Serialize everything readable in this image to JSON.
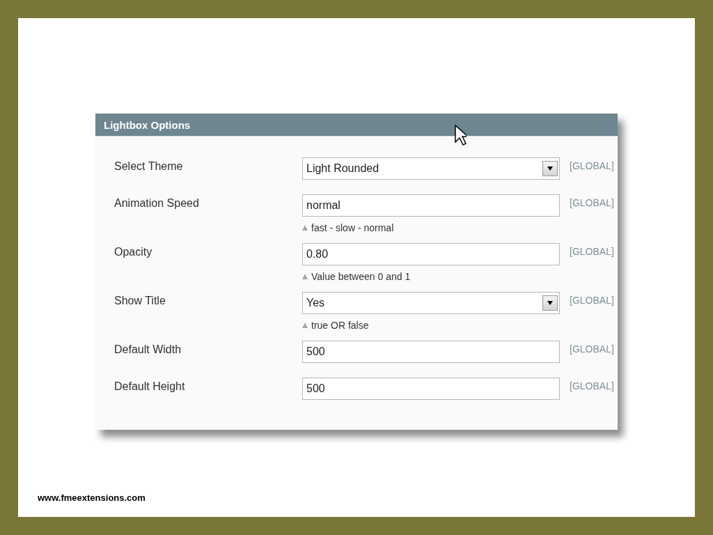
{
  "panel": {
    "title": "Lightbox Options"
  },
  "rows": [
    {
      "label": "Select Theme",
      "kind": "select",
      "value": "Light Rounded",
      "scope": "[GLOBAL]"
    },
    {
      "label": "Animation Speed",
      "kind": "text",
      "value": "normal",
      "note": "fast - slow - normal",
      "scope": "[GLOBAL]"
    },
    {
      "label": "Opacity",
      "kind": "text",
      "value": "0.80",
      "note": "Value between 0 and 1",
      "scope": "[GLOBAL]"
    },
    {
      "label": "Show Title",
      "kind": "select",
      "value": "Yes",
      "note": "true OR false",
      "scope": "[GLOBAL]"
    },
    {
      "label": "Default Width",
      "kind": "text",
      "value": "500",
      "scope": "[GLOBAL]"
    },
    {
      "label": "Default Height",
      "kind": "text",
      "value": "500",
      "scope": "[GLOBAL]"
    }
  ],
  "footer": "www.fmeextensions.com"
}
